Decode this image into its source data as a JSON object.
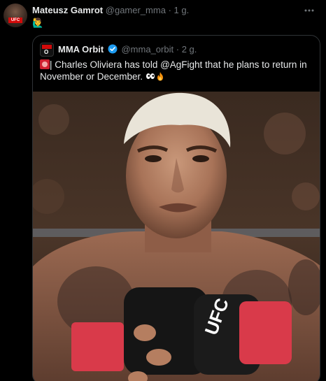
{
  "post": {
    "author_name": "Mateusz Gamrot",
    "author_handle": "@gamer_mma",
    "separator": "·",
    "time": "1 g.",
    "avatar_tag": "UFC",
    "body_emoji": "🙋‍♂️"
  },
  "quoted": {
    "author_name": "MMA Orbit",
    "author_handle": "@mma_orbit",
    "separator": "·",
    "time": "2 g.",
    "avatar_label": "O",
    "text": "| Charles Oliviera has told @AgFight that he plans to return in November or December.",
    "media_glove_text": "UFC"
  },
  "colors": {
    "background": "#000000",
    "primary_text": "#e7e9ea",
    "secondary_text": "#71767b",
    "border": "#2f3336",
    "verified": "#1d9bf0",
    "ufc_red": "#d20a0a"
  },
  "icons": {
    "more": "more-horizontal-icon",
    "verified": "verified-badge-icon",
    "alert": "rotating-light-icon",
    "eyes": "eyes-icon",
    "fire": "fire-icon"
  }
}
